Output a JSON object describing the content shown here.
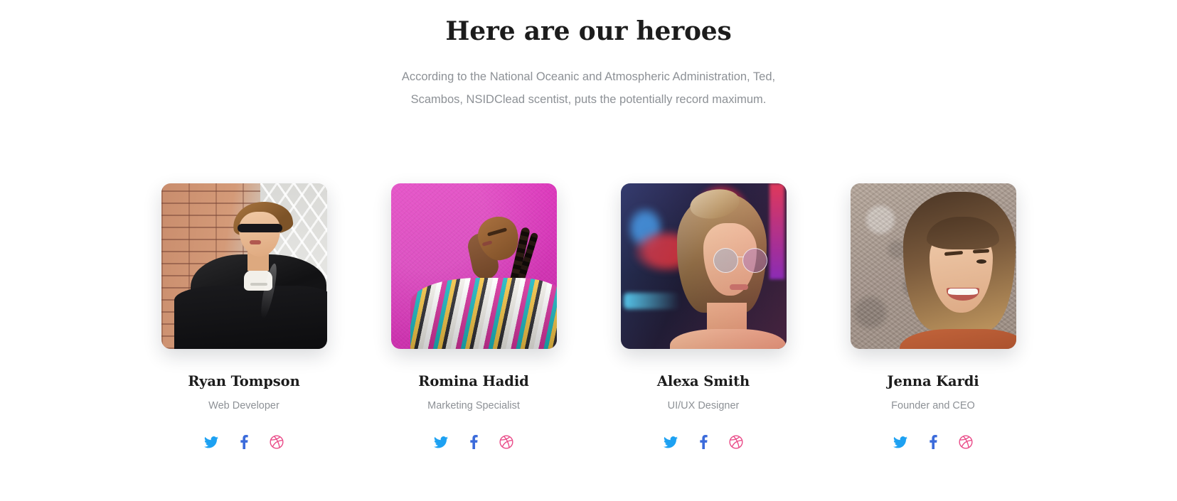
{
  "header": {
    "title": "Here are our heroes",
    "subtitle": "According to the National Oceanic and Atmospheric Administration, Ted, Scambos, NSIDClead scentist, puts the potentially record maximum."
  },
  "colors": {
    "page_background": "#ffffff",
    "heading": "#1c1c1c",
    "muted_text": "#8d9196",
    "twitter": "#1da1f2",
    "facebook": "#3b6bdb",
    "dribbble": "#ea4c89"
  },
  "social_labels": {
    "twitter": "Twitter",
    "facebook": "Facebook",
    "dribbble": "Dribbble"
  },
  "team": [
    {
      "name": "Ryan Tompson",
      "role": "Web Developer",
      "photo_alt": "Man in black leather jacket and sunglasses in front of a brick wall",
      "socials": [
        "twitter-icon",
        "facebook-icon",
        "dribbble-icon"
      ]
    },
    {
      "name": "Romina Hadid",
      "role": "Marketing Specialist",
      "photo_alt": "Woman with long braids wearing a colorful patterned top against a pink wall",
      "socials": [
        "twitter-icon",
        "facebook-icon",
        "dribbble-icon"
      ]
    },
    {
      "name": "Alexa Smith",
      "role": "UI/UX Designer",
      "photo_alt": "Woman with glasses lit by neon city lights",
      "socials": [
        "twitter-icon",
        "facebook-icon",
        "dribbble-icon"
      ]
    },
    {
      "name": "Jenna Kardi",
      "role": "Founder and CEO",
      "photo_alt": "Smiling woman with fringe in an orange top in front of a stone wall",
      "socials": [
        "twitter-icon",
        "facebook-icon",
        "dribbble-icon"
      ]
    }
  ]
}
